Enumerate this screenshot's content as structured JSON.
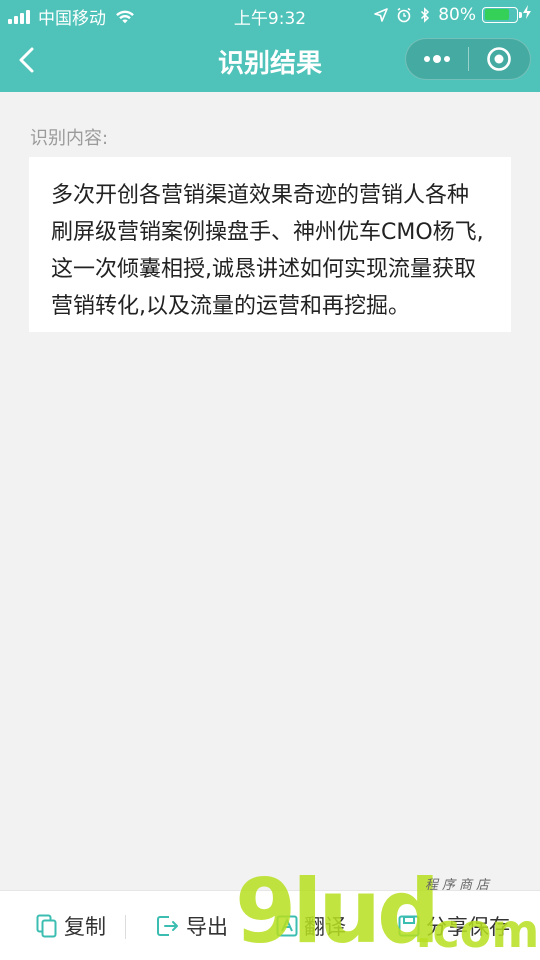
{
  "status_bar": {
    "carrier": "中国移动",
    "time": "上午9:32",
    "battery_percent": "80%",
    "battery_level": 0.8
  },
  "nav": {
    "title": "识别结果",
    "icons": {
      "back": "chevron-left-icon",
      "more": "more-dots-icon",
      "close": "target-close-icon"
    }
  },
  "content": {
    "label": "识别内容:",
    "text": "多次开创各营销渠道效果奇迹的营销人各种刷屏级营销案例操盘手、神州优车CMO杨飞,这一次倾囊相授,诚恳讲述如何实现流量获取营销转化,以及流量的运营和再挖掘。"
  },
  "toolbar": {
    "copy": "复制",
    "export": "导出",
    "translate": "翻译",
    "share_save": "分享保存"
  },
  "watermark": {
    "main": "9lud",
    "suffix": ".com",
    "sub": "程序商店"
  },
  "colors": {
    "accent": "#4fc3b9",
    "tool_icon": "#3cbdb2",
    "battery": "#34d058"
  }
}
